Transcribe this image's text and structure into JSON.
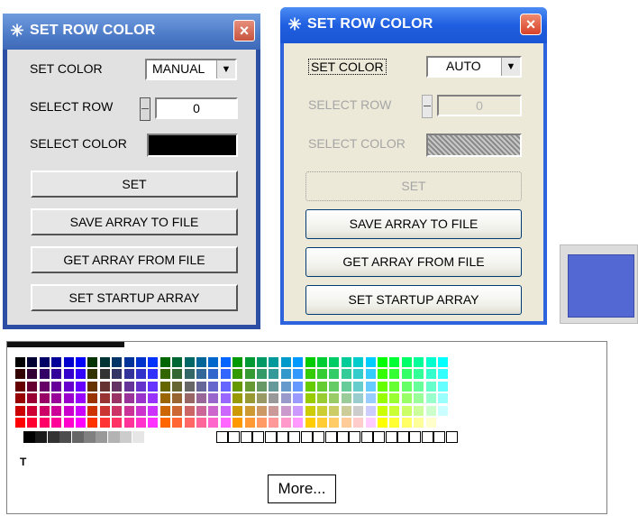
{
  "window_left": {
    "title": "SET ROW COLOR",
    "close": "×",
    "set_color_label": "SET COLOR",
    "set_color_value": "MANUAL",
    "select_row_label": "SELECT ROW",
    "select_row_value": "0",
    "select_color_label": "SELECT COLOR",
    "selected_color": "#000000",
    "buttons": [
      "SET",
      "SAVE ARRAY TO FILE",
      "GET ARRAY FROM FILE",
      "SET STARTUP ARRAY"
    ]
  },
  "window_right": {
    "title": "SET ROW COLOR",
    "close": "×",
    "set_color_label": "SET COLOR",
    "set_color_value": "AUTO",
    "select_row_label": "SELECT ROW",
    "select_row_value": "0",
    "select_color_label": "SELECT COLOR",
    "buttons": [
      "SET",
      "SAVE ARRAY TO FILE",
      "GET ARRAY FROM FILE",
      "SET STARTUP ARRAY"
    ]
  },
  "preview": {
    "color": "#5468d4"
  },
  "palette": {
    "transparent_label": "T",
    "more_label": "More...",
    "grays": [
      "#000000",
      "#1a1a1a",
      "#333333",
      "#4d4d4d",
      "#666666",
      "#808080",
      "#999999",
      "#b3b3b3",
      "#cccccc",
      "#e6e6e6"
    ],
    "custom_slots": 20
  },
  "icons": {
    "title_icon": "starburst-icon",
    "close_icon": "close-icon",
    "dropdown_icon": "chevron-down-icon"
  }
}
